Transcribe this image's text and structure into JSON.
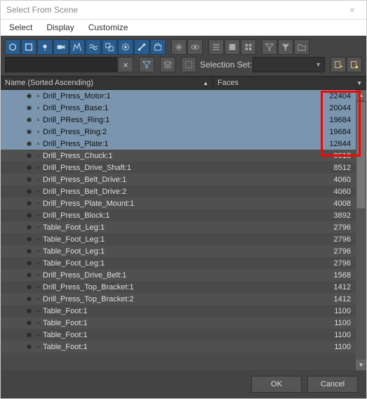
{
  "window": {
    "title": "Select From Scene"
  },
  "menubar": {
    "items": [
      "Select",
      "Display",
      "Customize"
    ]
  },
  "toolbar": {
    "search_placeholder": "",
    "selection_set_label": "Selection Set:",
    "selection_set_marker": "▼"
  },
  "headers": {
    "name": "Name (Sorted Ascending)",
    "name_arrow": "▲",
    "faces": "Faces",
    "faces_arrow": "▼"
  },
  "rows": [
    {
      "name": "Drill_Press_Motor:1",
      "faces": "22404",
      "selected": true
    },
    {
      "name": "Drill_Press_Base:1",
      "faces": "20044",
      "selected": true
    },
    {
      "name": "Drill_PRess_Ring:1",
      "faces": "19684",
      "selected": true
    },
    {
      "name": "Drill_Press_Ring:2",
      "faces": "19684",
      "selected": true
    },
    {
      "name": "Drill_Press_Plate:1",
      "faces": "12644",
      "selected": true
    },
    {
      "name": "Drill_Press_Chuck:1",
      "faces": "9618",
      "selected": false
    },
    {
      "name": "Drill_Press_Drive_Shaft:1",
      "faces": "8512",
      "selected": false
    },
    {
      "name": "Drill_Press_Belt_Drive:1",
      "faces": "4060",
      "selected": false
    },
    {
      "name": "Drill_Press_Belt_Drive:2",
      "faces": "4060",
      "selected": false
    },
    {
      "name": "Drill_Press_Plate_Mount:1",
      "faces": "4008",
      "selected": false
    },
    {
      "name": "Drill_Press_Block:1",
      "faces": "3892",
      "selected": false
    },
    {
      "name": "Table_Foot_Leg:1",
      "faces": "2796",
      "selected": false
    },
    {
      "name": "Table_Foot_Leg:1",
      "faces": "2796",
      "selected": false
    },
    {
      "name": "Table_Foot_Leg:1",
      "faces": "2796",
      "selected": false
    },
    {
      "name": "Table_Foot_Leg:1",
      "faces": "2796",
      "selected": false
    },
    {
      "name": "Drill_Press_Drive_Belt:1",
      "faces": "1568",
      "selected": false
    },
    {
      "name": "Drill_Press_Top_Bracket:1",
      "faces": "1412",
      "selected": false
    },
    {
      "name": "Drill_Press_Top_Bracket:2",
      "faces": "1412",
      "selected": false
    },
    {
      "name": "Table_Foot:1",
      "faces": "1100",
      "selected": false
    },
    {
      "name": "Table_Foot:1",
      "faces": "1100",
      "selected": false
    },
    {
      "name": "Table_Foot:1",
      "faces": "1100",
      "selected": false
    },
    {
      "name": "Table_Foot:1",
      "faces": "1100",
      "selected": false
    }
  ],
  "footer": {
    "ok": "OK",
    "cancel": "Cancel"
  }
}
